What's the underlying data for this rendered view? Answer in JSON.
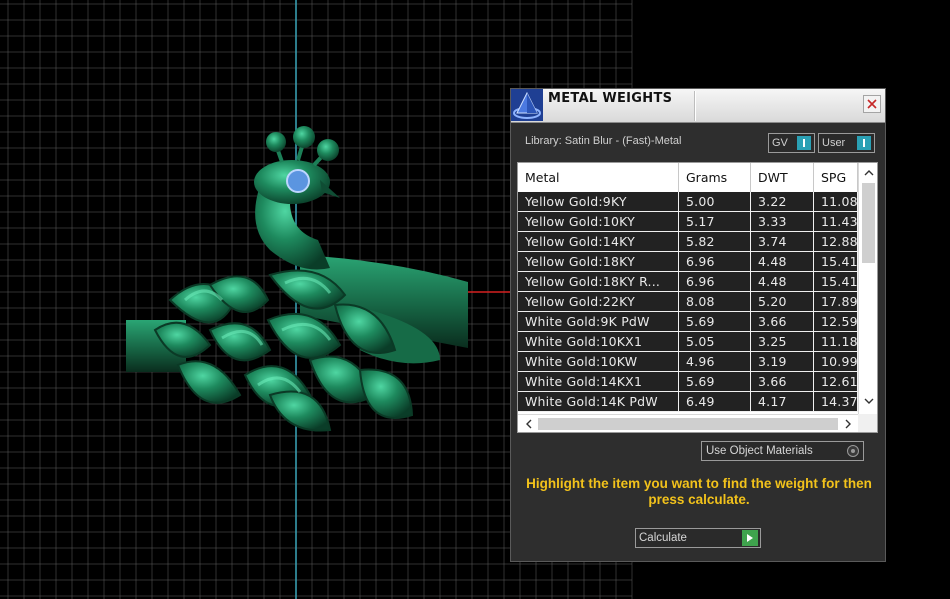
{
  "panel": {
    "title": "METAL WEIGHTS",
    "library_label": "Library: Satin Blur - (Fast)-Metal",
    "toggle_gv": "GV",
    "toggle_user": "User",
    "use_object_materials": "Use Object Materials",
    "hint": "Highlight the item you want to find the weight for then press calculate.",
    "calculate_label": "Calculate"
  },
  "table": {
    "headers": [
      "Metal",
      "Grams",
      "DWT",
      "SPG"
    ],
    "rows": [
      [
        "Yellow Gold:9KY",
        "5.00",
        "3.22",
        "11.08"
      ],
      [
        "Yellow Gold:10KY",
        "5.17",
        "3.33",
        "11.43"
      ],
      [
        "Yellow Gold:14KY",
        "5.82",
        "3.74",
        "12.88"
      ],
      [
        "Yellow Gold:18KY",
        "6.96",
        "4.48",
        "15.41"
      ],
      [
        "Yellow Gold:18KY R...",
        "6.96",
        "4.48",
        "15.41"
      ],
      [
        "Yellow Gold:22KY",
        "8.08",
        "5.20",
        "17.89"
      ],
      [
        "White Gold:9K PdW",
        "5.69",
        "3.66",
        "12.59"
      ],
      [
        "White Gold:10KX1",
        "5.05",
        "3.25",
        "11.18"
      ],
      [
        "White Gold:10KW",
        "4.96",
        "3.19",
        "10.99"
      ],
      [
        "White Gold:14KX1",
        "5.69",
        "3.66",
        "12.61"
      ],
      [
        "White Gold:14K PdW",
        "6.49",
        "4.17",
        "14.37"
      ]
    ]
  },
  "colors": {
    "model_green": "#1d7a55",
    "hint_yellow": "#f2c21b",
    "toggle_teal": "#2aa0b4",
    "play_green": "#3fa34d",
    "grid_line": "#5a5a5a",
    "axis_cyan": "#3aa6b9",
    "axis_red": "#d62020"
  },
  "icons": {
    "app": "pyramid-logo-icon",
    "close": "close-icon",
    "play": "play-icon"
  }
}
